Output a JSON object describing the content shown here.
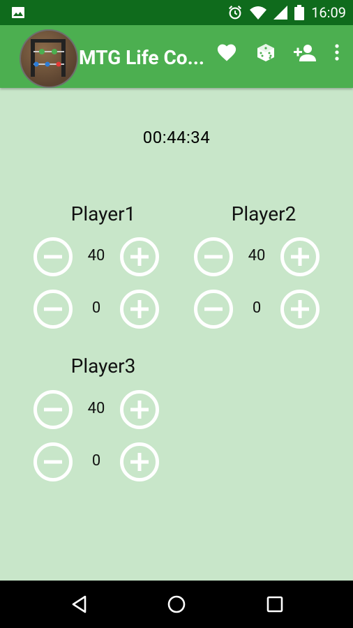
{
  "status": {
    "time": "16:09"
  },
  "app": {
    "title": "MTG Life Co..."
  },
  "timer": "00:44:34",
  "players": [
    {
      "name": "Player1",
      "life": "40",
      "poison": "0"
    },
    {
      "name": "Player2",
      "life": "40",
      "poison": "0"
    },
    {
      "name": "Player3",
      "life": "40",
      "poison": "0"
    }
  ],
  "colors": {
    "status_bar": "#0f6b1c",
    "app_bar": "#4caf50",
    "background": "#c8e6c9",
    "buttons": "#ffffff"
  },
  "icons": {
    "status_left": "image-icon",
    "alarm": "alarm-icon",
    "wifi": "wifi-icon",
    "signal": "signal-icon",
    "battery": "battery-icon",
    "favorite": "heart-icon",
    "dice": "dice-icon",
    "add_player": "add-person-icon",
    "menu": "more-vert-icon"
  }
}
